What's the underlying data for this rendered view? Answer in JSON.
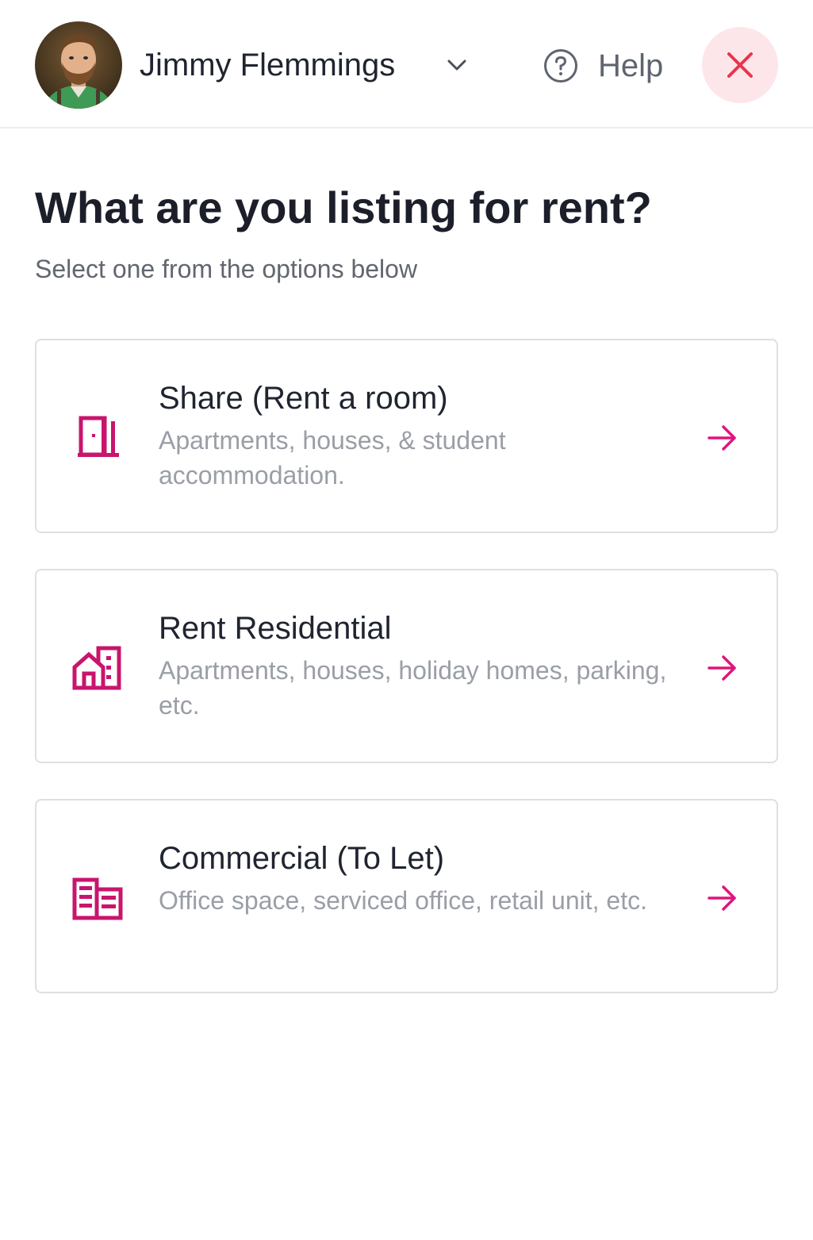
{
  "header": {
    "user_name": "Jimmy Flemmings",
    "help_label": "Help",
    "avatar_icon": "user-avatar-photo",
    "dropdown_icon": "chevron-down-icon",
    "help_icon": "question-circle-icon",
    "close_icon": "close-icon"
  },
  "main": {
    "title": "What are you listing for rent?",
    "subtitle": "Select one from the options below",
    "options": [
      {
        "title": "Share (Rent a room)",
        "description": "Apartments, houses, & student accommodation.",
        "icon": "door-icon"
      },
      {
        "title": "Rent Residential",
        "description": "Apartments, houses, holiday homes, parking, etc.",
        "icon": "house-building-icon"
      },
      {
        "title": "Commercial (To Let)",
        "description": "Office space, serviced office, retail unit, etc.",
        "icon": "office-building-icon"
      }
    ]
  },
  "colors": {
    "accent": "#e0147f",
    "icon_magenta": "#c8156d",
    "close_bg": "#fde6e9",
    "close_x": "#e8344e",
    "title_text": "#1c1f2a",
    "muted_text": "#9a9ea6",
    "border": "#dedfe3"
  }
}
